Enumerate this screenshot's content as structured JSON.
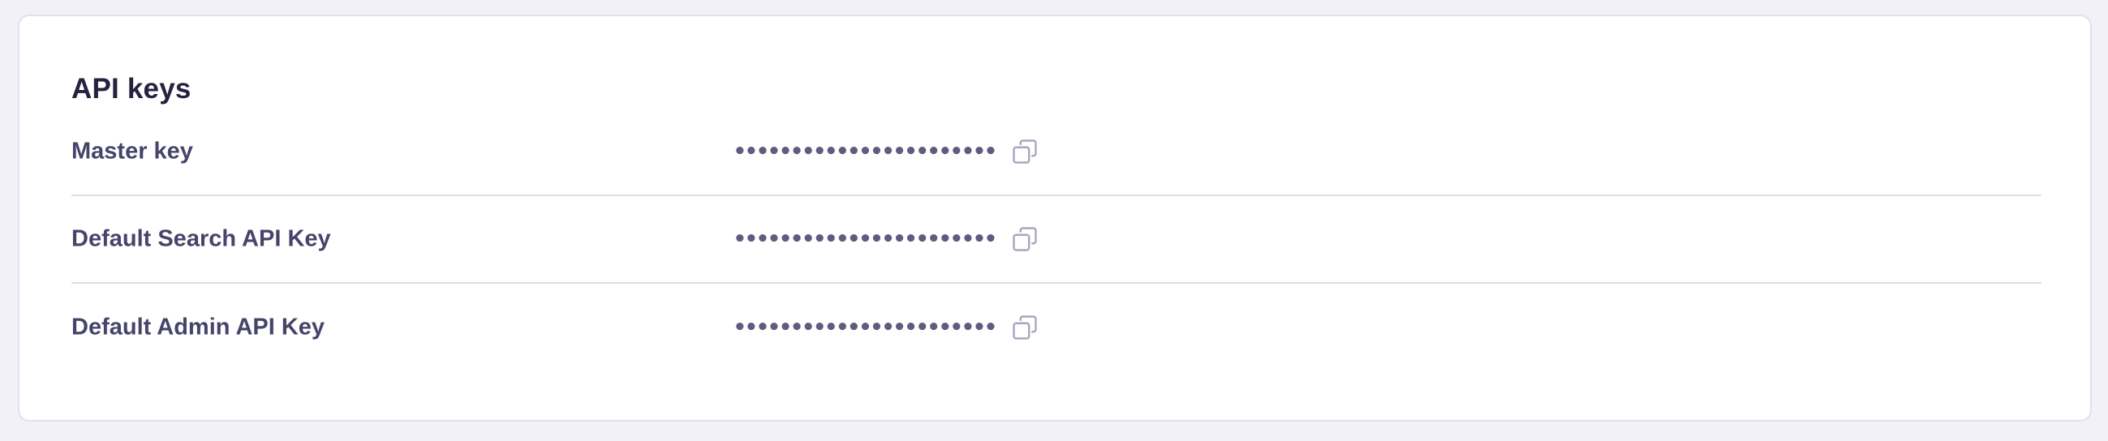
{
  "section": {
    "title": "API keys"
  },
  "keys": [
    {
      "label": "Master key",
      "masked_value": "•••••••••••••••••••••••",
      "icon": "copy-icon"
    },
    {
      "label": "Default Search API Key",
      "masked_value": "•••••••••••••••••••••••",
      "icon": "copy-icon"
    },
    {
      "label": "Default Admin API Key",
      "masked_value": "•••••••••••••••••••••••",
      "icon": "copy-icon"
    }
  ],
  "colors": {
    "background": "#f2f1f8",
    "card": "#ffffff",
    "title": "#24223f",
    "label": "#46446a",
    "masked": "#5e5c80",
    "icon": "#a7a5c1",
    "divider": "#dedde6"
  }
}
